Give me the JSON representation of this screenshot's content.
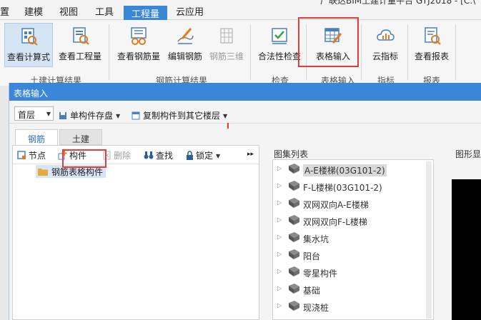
{
  "title_fragment": "广联达BIM土建计量平台 GTJ2018 - [C:\\",
  "menu": [
    "置",
    "建模",
    "视图",
    "工具",
    "工程量",
    "云应用"
  ],
  "ribbon": {
    "buttons": {
      "calc_formula": "查看计算式",
      "view_quantity": "查看工程量",
      "view_rebar": "查看钢筋量",
      "edit_rebar": "编辑钢筋",
      "rebar_3d": "钢筋三维",
      "legality_check": "合法性检查",
      "table_input": "表格输入",
      "cloud_index": "云指标",
      "view_report": "查看报表"
    },
    "groups": {
      "civil_result": "土建计算结果",
      "rebar_result": "钢筋计算结果",
      "check": "检查",
      "table_input": "表格输入",
      "index": "指标",
      "report": "报表"
    }
  },
  "dialog": {
    "title": "表格输入",
    "floor": "首层",
    "save_component": "单构件存盘",
    "copy_to_floor": "复制构件到其它楼层",
    "tabs": [
      "钢筋",
      "土建"
    ],
    "left_toolbar": {
      "node": "节点",
      "component": "构件",
      "delete": "删除",
      "find": "查找",
      "lock": "锁定"
    },
    "tree_root": "钢筋表格构件",
    "atlas_header": "图集列表",
    "graphic_header": "图形显示",
    "atlas_items": [
      "A-E楼梯(03G101-2)",
      "F-L楼梯(03G101-2)",
      "双网双向A-E楼梯",
      "双网双向F-L楼梯",
      "集水坑",
      "阳台",
      "零星构件",
      "基础",
      "现浇桩"
    ]
  },
  "colors": {
    "accent": "#3a86d9",
    "highlight": "#e43b3b"
  }
}
